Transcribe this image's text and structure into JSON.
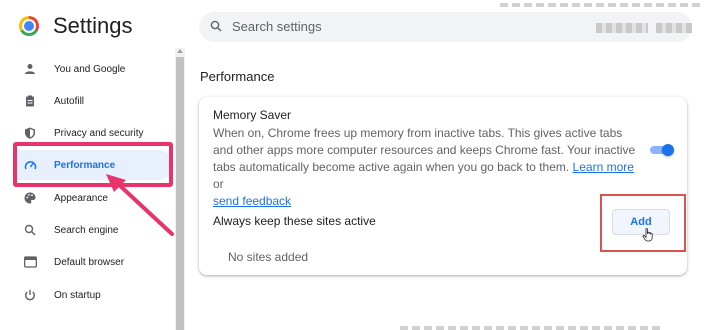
{
  "app": {
    "title": "Settings"
  },
  "search": {
    "placeholder": "Search settings",
    "value": ""
  },
  "sidebar": {
    "items": [
      {
        "label": "You and Google",
        "icon": "person-icon"
      },
      {
        "label": "Autofill",
        "icon": "clipboard-icon"
      },
      {
        "label": "Privacy and security",
        "icon": "shield-icon"
      },
      {
        "label": "Performance",
        "icon": "speedometer-icon",
        "active": true
      },
      {
        "label": "Appearance",
        "icon": "palette-icon"
      },
      {
        "label": "Search engine",
        "icon": "search-icon"
      },
      {
        "label": "Default browser",
        "icon": "browser-icon"
      },
      {
        "label": "On startup",
        "icon": "power-icon"
      }
    ]
  },
  "main": {
    "section_title": "Performance",
    "memory_saver": {
      "title": "Memory Saver",
      "description": "When on, Chrome frees up memory from inactive tabs. This gives active tabs and other apps more computer resources and keeps Chrome fast. Your inactive tabs automatically become active again when you go back to them.",
      "learn_more": "Learn more",
      "or_text": " or",
      "send_feedback": "send feedback",
      "enabled": true
    },
    "keep_active": {
      "label": "Always keep these sites active",
      "add_label": "Add",
      "empty_text": "No sites added"
    }
  },
  "colors": {
    "accent": "#1a73e8",
    "highlight": "#e8336b",
    "outline": "#d9534f"
  }
}
